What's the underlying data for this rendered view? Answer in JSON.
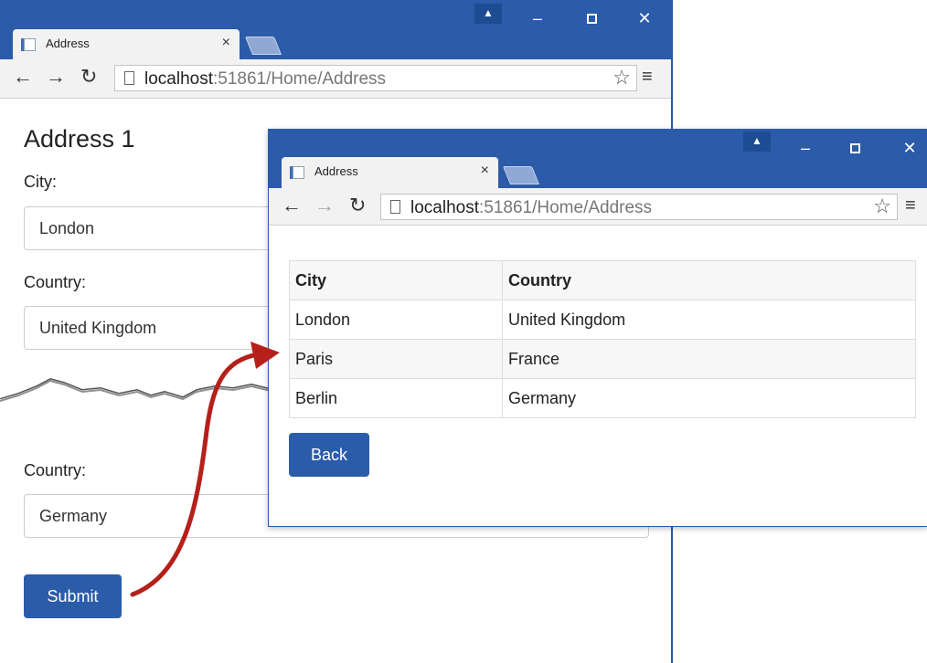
{
  "window1": {
    "tab_title": "Address",
    "tab_close": "×",
    "url_host": "localhost",
    "url_rest": ":51861/Home/Address",
    "heading": "Address 1",
    "city_label": "City:",
    "city_value": "London",
    "country_label": "Country:",
    "country_value": "United Kingdom",
    "country2_label": "Country:",
    "country2_value": "Germany",
    "submit_label": "Submit"
  },
  "window2": {
    "tab_title": "Address",
    "tab_close": "×",
    "url_host": "localhost",
    "url_rest": ":51861/Home/Address",
    "table": {
      "headers": [
        "City",
        "Country"
      ],
      "rows": [
        [
          "London",
          "United Kingdom"
        ],
        [
          "Paris",
          "France"
        ],
        [
          "Berlin",
          "Germany"
        ]
      ]
    },
    "back_label": "Back"
  },
  "colors": {
    "titlebar": "#2b5ba9",
    "button": "#2b5ca9",
    "arrow": "#b5201b"
  },
  "icons": [
    "back-arrow-icon",
    "forward-arrow-icon",
    "reload-icon",
    "page-icon",
    "star-icon",
    "menu-icon",
    "profile-icon",
    "minimize-icon",
    "maximize-icon",
    "close-icon"
  ]
}
